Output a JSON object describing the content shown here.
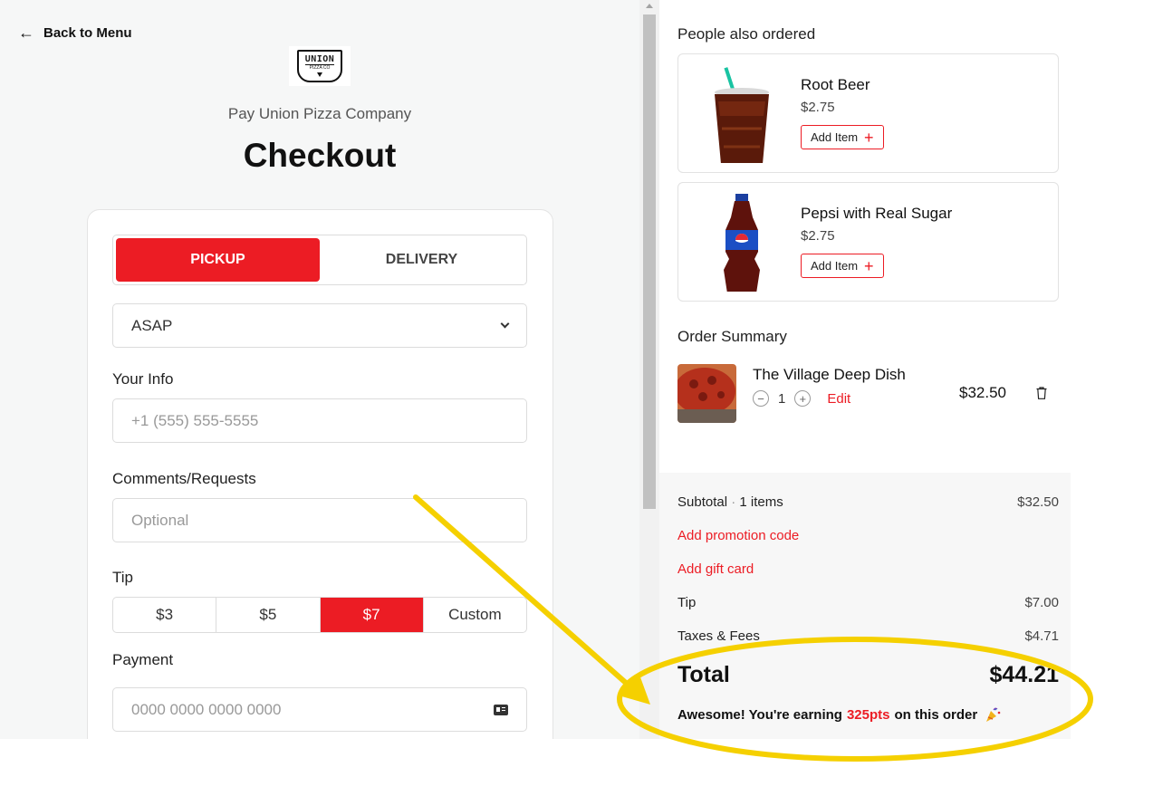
{
  "left": {
    "back_label": "Back to Menu",
    "logo": {
      "main": "UNION",
      "sub": "PIZZA CO"
    },
    "pay_title": "Pay Union Pizza Company",
    "title": "Checkout",
    "tabs": [
      {
        "label": "PICKUP",
        "active": true
      },
      {
        "label": "DELIVERY",
        "active": false
      }
    ],
    "time_select": "ASAP",
    "your_info_label": "Your Info",
    "phone_placeholder": "+1  (555) 555-5555",
    "comments_label": "Comments/Requests",
    "comments_placeholder": "Optional",
    "tip_label": "Tip",
    "tips": [
      {
        "label": "$3",
        "active": false
      },
      {
        "label": "$5",
        "active": false
      },
      {
        "label": "$7",
        "active": true
      },
      {
        "label": "Custom",
        "active": false
      }
    ],
    "payment_label": "Payment",
    "card_placeholder": "0000 0000 0000 0000"
  },
  "right": {
    "also_ordered_heading": "People also ordered",
    "recommendations": [
      {
        "name": "Root Beer",
        "price": "$2.75",
        "add_label": "Add Item"
      },
      {
        "name": "Pepsi with Real Sugar",
        "price": "$2.75",
        "add_label": "Add Item"
      }
    ],
    "order_summary_heading": "Order Summary",
    "order_item": {
      "name": "The Village Deep Dish",
      "quantity": "1",
      "edit_label": "Edit",
      "price": "$32.50"
    },
    "summary": {
      "subtotal_label": "Subtotal",
      "items_count": "1 items",
      "subtotal_value": "$32.50",
      "promo_link": "Add promotion code",
      "gift_card_link": "Add gift card",
      "tip_label": "Tip",
      "tip_value": "$7.00",
      "taxes_label": "Taxes & Fees",
      "taxes_value": "$4.71",
      "total_label": "Total",
      "total_value": "$44.21",
      "earn_prefix": "Awesome! You're earning",
      "earn_points": "325pts",
      "earn_suffix": "on this order"
    }
  },
  "colors": {
    "accent": "#ec1c24",
    "highlight": "#f5d000"
  },
  "icons": [
    "arrow-left-icon",
    "chevron-down-icon",
    "credit-card-icon",
    "plus-icon",
    "minus-icon",
    "trash-icon",
    "party-popper-icon"
  ]
}
